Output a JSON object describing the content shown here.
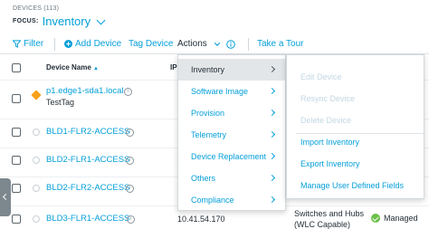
{
  "header": {
    "breadcrumb": "DEVICES (113)",
    "focus_label": "FOCUS:",
    "focus_value": "Inventory"
  },
  "toolbar": {
    "filter": "Filter",
    "add_device": "Add Device",
    "tag_device": "Tag Device",
    "actions": "Actions",
    "take_tour": "Take a Tour"
  },
  "table": {
    "col_device_name": "Device Name",
    "col_ip_partial": "IP",
    "rows": [
      {
        "name": "p1.edge1-sda1.local",
        "tag": "TestTag"
      },
      {
        "name": "BLD1-FLR2-ACCESS"
      },
      {
        "name": "BLD2-FLR1-ACCESS"
      },
      {
        "name": "BLD2-FLR2-ACCESS"
      },
      {
        "name": "BLD3-FLR1-ACCESS",
        "ip_partial": "10.41.54.170",
        "type": "Switches and Hubs (WLC Capable)",
        "status": "Managed"
      }
    ]
  },
  "actions_menu": {
    "items": [
      "Inventory",
      "Software Image",
      "Provision",
      "Telemetry",
      "Device Replacement",
      "Others",
      "Compliance"
    ],
    "active_index": 0
  },
  "inventory_submenu": {
    "items": [
      {
        "label": "Edit Device",
        "disabled": true
      },
      {
        "label": "Resync Device",
        "disabled": true
      },
      {
        "label": "Delete Device",
        "disabled": true
      },
      {
        "label": "Import Inventory",
        "disabled": false
      },
      {
        "label": "Export Inventory",
        "disabled": false
      },
      {
        "label": "Manage User Defined Fields",
        "disabled": false
      }
    ]
  },
  "colors": {
    "link": "#049fd9",
    "managed": "#6cc04a",
    "tag": "#f7a21b"
  }
}
